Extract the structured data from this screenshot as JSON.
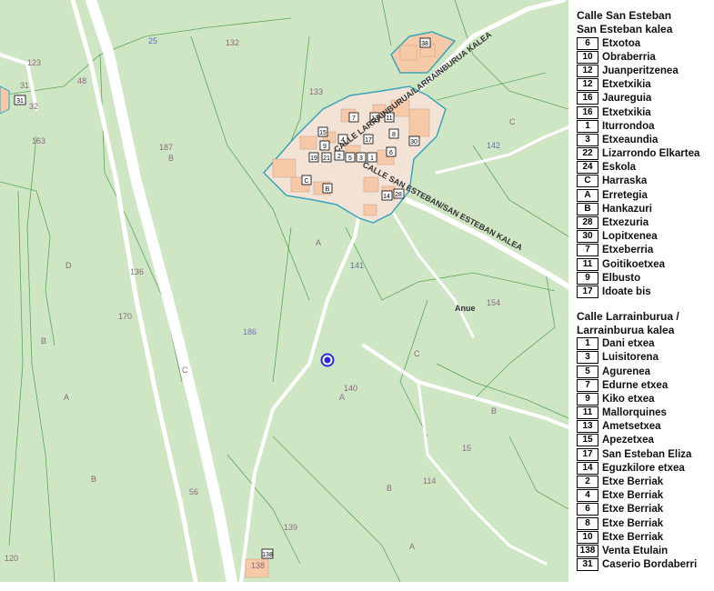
{
  "map": {
    "colors": {
      "land": "#cfe6c4",
      "road": "#ffffff",
      "building": "#f6c9a8",
      "boundary": "#3aa5b8",
      "marker": "#2a2ad8",
      "parcel_line": "#5aa55a"
    },
    "parcel_labels": [
      {
        "text": "25"
      },
      {
        "text": "132"
      },
      {
        "text": "123"
      },
      {
        "text": "48"
      },
      {
        "text": "31"
      },
      {
        "text": "32"
      },
      {
        "text": "163"
      },
      {
        "text": "133"
      },
      {
        "text": "187"
      },
      {
        "text": "B"
      },
      {
        "text": "C"
      },
      {
        "text": "142"
      },
      {
        "text": "D"
      },
      {
        "text": "136"
      },
      {
        "text": "141"
      },
      {
        "text": "170"
      },
      {
        "text": "186"
      },
      {
        "text": "154"
      },
      {
        "text": "Anue"
      },
      {
        "text": "140"
      },
      {
        "text": "A"
      },
      {
        "text": "B"
      },
      {
        "text": "15"
      },
      {
        "text": "56"
      },
      {
        "text": "114"
      },
      {
        "text": "139"
      },
      {
        "text": "138"
      },
      {
        "text": "120"
      },
      {
        "text": "C"
      },
      {
        "text": "B"
      },
      {
        "text": "A"
      },
      {
        "text": "B"
      },
      {
        "text": "C"
      },
      {
        "text": "A"
      },
      {
        "text": "B"
      },
      {
        "text": "A"
      }
    ],
    "street_labels": [
      {
        "text": "CALLE LARRAINBURUA/LARRAINBURUA KALEA"
      },
      {
        "text": "CALLE SAN ESTEBAN/SAN ESTEBAN KALEA"
      }
    ],
    "house_numbers": [
      "4",
      "7",
      "13",
      "11",
      "15",
      "9",
      "17",
      "2",
      "5",
      "3",
      "1",
      "19",
      "21",
      "8",
      "6",
      "30",
      "28",
      "B",
      "C",
      "14",
      "138",
      "31",
      "38"
    ]
  },
  "legend": {
    "sections": [
      {
        "title_lines": [
          "Calle San Esteban",
          "San Esteban kalea"
        ],
        "items": [
          {
            "num": "6",
            "name": "Etxotoa"
          },
          {
            "num": "10",
            "name": "Obraberria"
          },
          {
            "num": "12",
            "name": "Juanperitzenea"
          },
          {
            "num": "12",
            "name": "Etxetxikia"
          },
          {
            "num": "16",
            "name": "Jaureguia"
          },
          {
            "num": "16",
            "name": "Etxetxikia"
          },
          {
            "num": "1",
            "name": "Iturrondoa"
          },
          {
            "num": "3",
            "name": "Etxeaundia"
          },
          {
            "num": "22",
            "name": "Lizarrondo Elkartea"
          },
          {
            "num": "24",
            "name": "Eskola"
          },
          {
            "num": "C",
            "name": "Harraska"
          },
          {
            "num": "A",
            "name": "Erretegia"
          },
          {
            "num": "B",
            "name": "Hankazuri"
          },
          {
            "num": "28",
            "name": "Etxezuria"
          },
          {
            "num": "30",
            "name": "Lopitxenea"
          },
          {
            "num": "7",
            "name": "Etxeberria"
          },
          {
            "num": "11",
            "name": "Goitikoetxea"
          },
          {
            "num": "9",
            "name": "Elbusto"
          },
          {
            "num": "17",
            "name": "Idoate bis"
          }
        ]
      },
      {
        "title_lines": [
          "Calle Larrainburua /",
          "Larrainburua kalea"
        ],
        "items": [
          {
            "num": "1",
            "name": "Dani etxea"
          },
          {
            "num": "3",
            "name": "Luisitorena"
          },
          {
            "num": "5",
            "name": "Agurenea"
          },
          {
            "num": "7",
            "name": "Edurne etxea"
          },
          {
            "num": "9",
            "name": "Kiko etxea"
          },
          {
            "num": "11",
            "name": "Mallorquines"
          },
          {
            "num": "13",
            "name": "Ametsetxea"
          },
          {
            "num": "15",
            "name": "Apezetxea"
          },
          {
            "num": "17",
            "name": "San Esteban Eliza"
          },
          {
            "num": "14",
            "name": "Eguzkilore etxea"
          },
          {
            "num": "2",
            "name": "Etxe Berriak"
          },
          {
            "num": "4",
            "name": "Etxe Berriak"
          },
          {
            "num": "6",
            "name": "Etxe Berriak"
          },
          {
            "num": "8",
            "name": "Etxe Berriak"
          },
          {
            "num": "10",
            "name": "Etxe Berriak"
          },
          {
            "num": "138",
            "name": "Venta Etulain"
          },
          {
            "num": "31",
            "name": "Caserio Bordaberri"
          }
        ]
      }
    ]
  }
}
